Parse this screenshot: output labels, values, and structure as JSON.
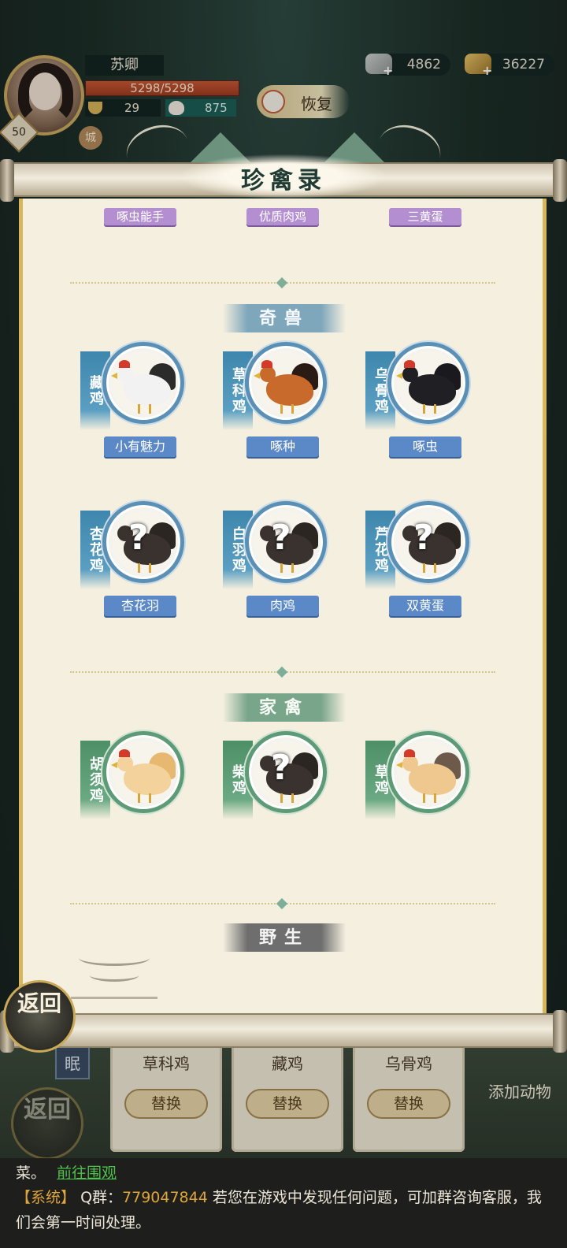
{
  "header": {
    "player_name": "苏卿",
    "level": "50",
    "hp": "5298/5298",
    "food": "29",
    "buns": "875",
    "restore_label": "恢复",
    "city_badge": "城",
    "stone": "4862",
    "coins": "36227"
  },
  "scroll": {
    "title": "珍禽录",
    "top_tags": [
      "啄虫能手",
      "优质肉鸡",
      "三黄蛋"
    ],
    "sections": [
      {
        "title": "奇兽",
        "animals": [
          {
            "name": "藏鸡",
            "trait": "小有魅力",
            "unlocked": true,
            "colors": [
              "#f2f2f2",
              "#2b2b2b"
            ]
          },
          {
            "name": "草科鸡",
            "trait": "啄种",
            "unlocked": true,
            "colors": [
              "#c86a2b",
              "#2a1c14"
            ]
          },
          {
            "name": "乌骨鸡",
            "trait": "啄虫",
            "unlocked": true,
            "colors": [
              "#1f1f24",
              "#1a1a1e"
            ]
          },
          {
            "name": "杏花鸡",
            "trait": "杏花羽",
            "unlocked": false
          },
          {
            "name": "白羽鸡",
            "trait": "肉鸡",
            "unlocked": false
          },
          {
            "name": "芦花鸡",
            "trait": "双黄蛋",
            "unlocked": false
          }
        ]
      },
      {
        "title": "家禽",
        "animals": [
          {
            "name": "胡须鸡",
            "unlocked": true,
            "colors": [
              "#f3d29c",
              "#e7b86f"
            ]
          },
          {
            "name": "柴鸡",
            "unlocked": false
          },
          {
            "name": "草鸡",
            "unlocked": true,
            "colors": [
              "#efc890",
              "#6d5a4a"
            ]
          }
        ]
      },
      {
        "title": "野生",
        "animals": []
      }
    ],
    "back_label": "返回"
  },
  "background": {
    "cards": [
      {
        "name": "草科鸡",
        "button": "替换"
      },
      {
        "name": "藏鸡",
        "button": "替换"
      },
      {
        "name": "乌骨鸡",
        "button": "替换"
      }
    ],
    "add_animal": "添加动物",
    "sleep": "眠",
    "back_label": "返回"
  },
  "chat": {
    "line1_prefix": "菜。",
    "line1_link": "前往围观",
    "sys_tag": "【系统】",
    "qq_prefix": "Q群：",
    "qq_number": "779047844",
    "message": "若您在游戏中发现任何问题，可加群咨询客服，我们会第一时间处理。"
  }
}
